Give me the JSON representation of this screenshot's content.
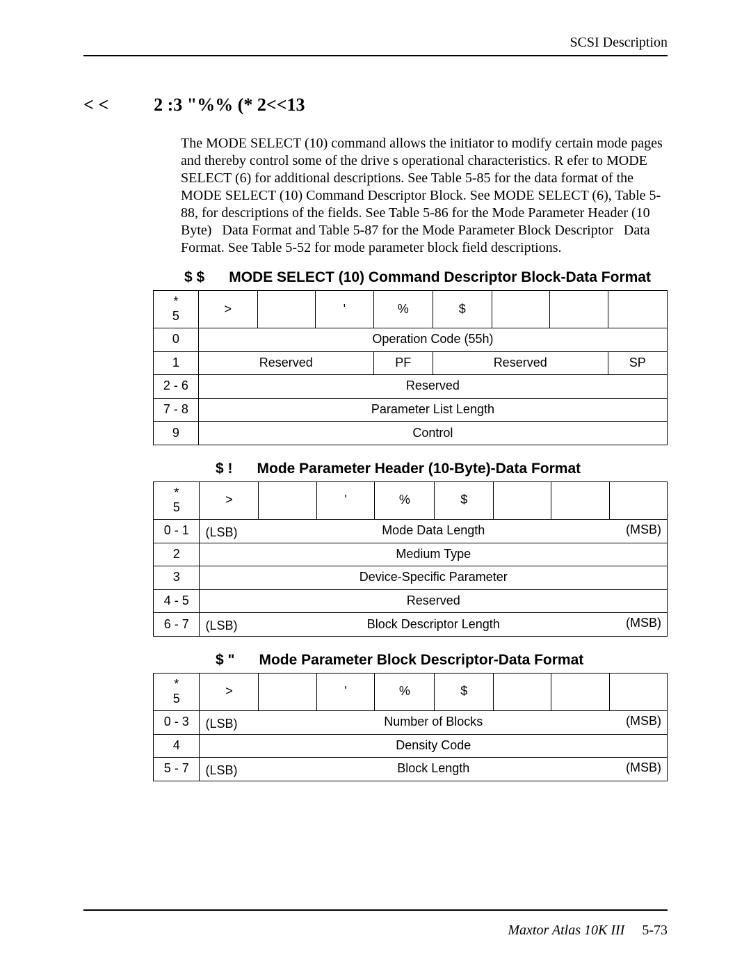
{
  "page_header_right": "SCSI Description",
  "section_heading": "< <          2 :3  \"%% (* 2<<13",
  "body_paragraph": "The MODE SELECT (10) command allows the initiator to modify certain mode pages and thereby control some of the drive s operational characteristics. R efer to MODE SELECT (6) for additional descriptions. See Table 5-85 for the data format of the MODE SELECT (10) Command Descriptor Block. See MODE SELECT (6), Table 5-88, for descriptions of the fields. See Table 5-86 for the Mode Parameter Header (10 Byte)   Data Format and Table 5-87 for the Mode Parameter Block Descriptor   Data Format. See Table 5-52 for mode parameter block field descriptions.",
  "tables": {
    "t85": {
      "caption": "$ $      MODE SELECT (10) Command Descriptor Block-Data Format",
      "byte_hdr_top": "*",
      "byte_hdr_bot": "5",
      "bit_hdrs": [
        ">",
        "",
        "'",
        "%",
        "$",
        "",
        "",
        ""
      ],
      "rows": [
        {
          "byte": "0",
          "cells": [
            {
              "span": 8,
              "text": "Operation Code (55h)",
              "cls": "center"
            }
          ]
        },
        {
          "byte": "1",
          "cells": [
            {
              "span": 3,
              "text": "Reserved",
              "cls": "center"
            },
            {
              "span": 1,
              "text": "PF",
              "cls": "center"
            },
            {
              "span": 3,
              "text": "Reserved",
              "cls": "center"
            },
            {
              "span": 1,
              "text": "SP",
              "cls": "center"
            }
          ]
        },
        {
          "byte": "2 - 6",
          "cells": [
            {
              "span": 8,
              "text": "Reserved",
              "cls": "center"
            }
          ]
        },
        {
          "byte": "7 - 8",
          "cells": [
            {
              "span": 8,
              "text": "Parameter List Length",
              "cls": "center"
            }
          ]
        },
        {
          "byte": "9",
          "cells": [
            {
              "span": 8,
              "text": "Control",
              "cls": "center"
            }
          ]
        }
      ]
    },
    "t86": {
      "caption": "$ !      Mode Parameter Header (10-Byte)-Data Format",
      "byte_hdr_top": "*",
      "byte_hdr_bot": "5",
      "bit_hdrs": [
        ">",
        "",
        "'",
        "%",
        "$",
        "",
        "",
        ""
      ],
      "rows": [
        {
          "byte": "0 - 1",
          "cells": [
            {
              "span": 8,
              "cls": "lsb-msb",
              "text": "Mode Data Length",
              "msb": "(MSB)",
              "lsb": "(LSB)"
            }
          ]
        },
        {
          "byte": "2",
          "cells": [
            {
              "span": 8,
              "text": "Medium Type",
              "cls": "center"
            }
          ]
        },
        {
          "byte": "3",
          "cells": [
            {
              "span": 8,
              "text": "Device-Specific Parameter",
              "cls": "center"
            }
          ]
        },
        {
          "byte": "4 - 5",
          "cells": [
            {
              "span": 8,
              "text": "Reserved",
              "cls": "center"
            }
          ]
        },
        {
          "byte": "6 - 7",
          "cells": [
            {
              "span": 8,
              "cls": "lsb-msb",
              "text": "Block Descriptor Length",
              "msb": "(MSB)",
              "lsb": "(LSB)"
            }
          ]
        }
      ]
    },
    "t87": {
      "caption": "$ \"      Mode Parameter Block Descriptor-Data Format",
      "byte_hdr_top": "*",
      "byte_hdr_bot": "5",
      "bit_hdrs": [
        ">",
        "",
        "'",
        "%",
        "$",
        "",
        "",
        ""
      ],
      "rows": [
        {
          "byte": "0 - 3",
          "cells": [
            {
              "span": 8,
              "cls": "lsb-msb",
              "text": "Number of Blocks",
              "msb": "(MSB)",
              "lsb": "(LSB)"
            }
          ]
        },
        {
          "byte": "4",
          "cells": [
            {
              "span": 8,
              "text": "Density Code",
              "cls": "center"
            }
          ]
        },
        {
          "byte": "5 - 7",
          "cells": [
            {
              "span": 8,
              "cls": "lsb-msb",
              "text": "Block Length",
              "msb": "(MSB)",
              "lsb": "(LSB)"
            }
          ]
        }
      ]
    }
  },
  "footer": {
    "title": "Maxtor Atlas 10K III",
    "page": "5-73"
  }
}
